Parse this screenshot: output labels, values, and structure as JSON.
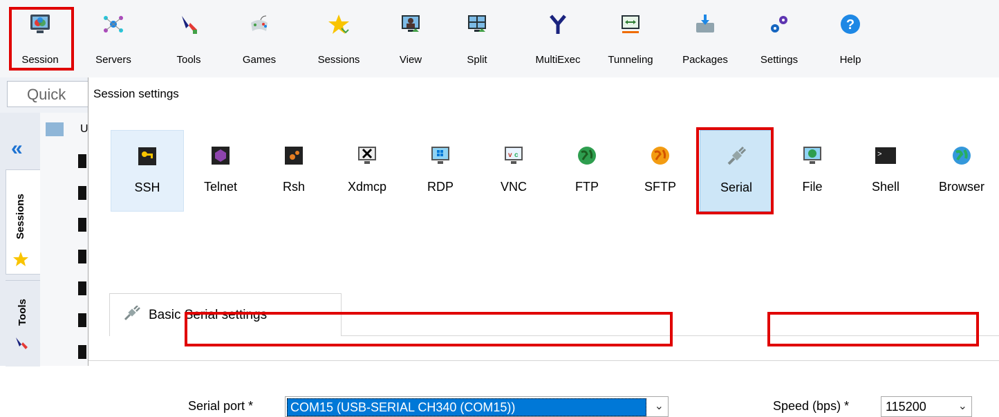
{
  "toolbar": {
    "items": [
      {
        "label": "Session",
        "icon": "session-icon"
      },
      {
        "label": "Servers",
        "icon": "servers-icon"
      },
      {
        "label": "Tools",
        "icon": "tools-icon"
      },
      {
        "label": "Games",
        "icon": "games-icon"
      },
      {
        "label": "Sessions",
        "icon": "star-icon"
      },
      {
        "label": "View",
        "icon": "view-icon"
      },
      {
        "label": "Split",
        "icon": "split-icon"
      },
      {
        "label": "MultiExec",
        "icon": "multiexec-icon"
      },
      {
        "label": "Tunneling",
        "icon": "tunneling-icon"
      },
      {
        "label": "Packages",
        "icon": "packages-icon"
      },
      {
        "label": "Settings",
        "icon": "gears-icon"
      },
      {
        "label": "Help",
        "icon": "help-icon"
      }
    ]
  },
  "quick_connect": {
    "text": "Quick"
  },
  "side_tabs": {
    "sessions": "Sessions",
    "tools": "Tools"
  },
  "tree": {
    "root_label": "U"
  },
  "dialog": {
    "title": "Session settings",
    "protocols": [
      {
        "label": "SSH",
        "icon": "key-icon"
      },
      {
        "label": "Telnet",
        "icon": "telnet-icon"
      },
      {
        "label": "Rsh",
        "icon": "rsh-icon"
      },
      {
        "label": "Xdmcp",
        "icon": "xdmcp-icon"
      },
      {
        "label": "RDP",
        "icon": "rdp-icon"
      },
      {
        "label": "VNC",
        "icon": "vnc-icon"
      },
      {
        "label": "FTP",
        "icon": "globe-icon"
      },
      {
        "label": "SFTP",
        "icon": "globe-orange-icon"
      },
      {
        "label": "Serial",
        "icon": "serial-plug-icon"
      },
      {
        "label": "File",
        "icon": "file-monitor-icon"
      },
      {
        "label": "Shell",
        "icon": "terminal-icon"
      },
      {
        "label": "Browser",
        "icon": "browser-globe-icon"
      }
    ],
    "selected_protocol": "Serial",
    "tab": {
      "label": "Basic Serial settings"
    },
    "serial_port": {
      "label": "Serial port *",
      "value": "COM15  (USB-SERIAL CH340 (COM15))"
    },
    "speed": {
      "label": "Speed (bps) *",
      "value": "115200"
    }
  },
  "colors": {
    "highlight": "#e00000",
    "selection": "#0078d7",
    "selected_tile": "#cde6f7"
  }
}
